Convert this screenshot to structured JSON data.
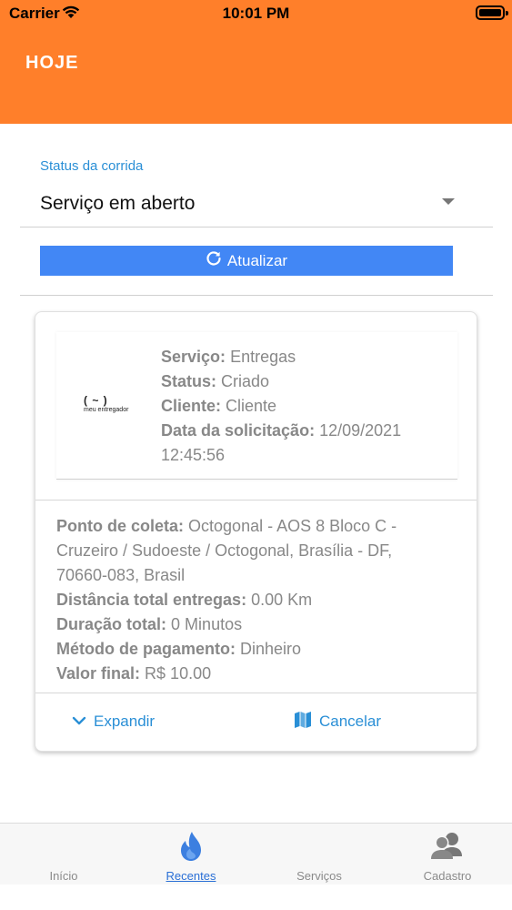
{
  "status_bar": {
    "carrier": "Carrier",
    "time": "10:01 PM"
  },
  "header": {
    "title": "HOJE",
    "color": "#ff7f2a"
  },
  "filter": {
    "label": "Status da corrida",
    "value": "Serviço em aberto"
  },
  "refresh_button": {
    "label": "Atualizar",
    "color": "#4287f5"
  },
  "card": {
    "head": [
      {
        "label": "Serviço:",
        "value": "Entregas"
      },
      {
        "label": "Status:",
        "value": "Criado"
      },
      {
        "label": "Cliente:",
        "value": "Cliente"
      },
      {
        "label": "Data da solicitação:",
        "value": "12/09/2021 12:45:56"
      }
    ],
    "logo_text": "meu entregador",
    "body": [
      {
        "label": "Ponto de coleta:",
        "value": "Octogonal - AOS 8 Bloco C - Cruzeiro / Sudoeste / Octogonal, Brasília - DF, 70660-083, Brasil"
      },
      {
        "label": "Distância total entregas:",
        "value": "0.00 Km"
      },
      {
        "label": "Duração total:",
        "value": "0 Minutos"
      },
      {
        "label": "Método de pagamento:",
        "value": "Dinheiro"
      },
      {
        "label": "Valor final:",
        "value": "R$ 10.00"
      }
    ],
    "actions": {
      "expand": "Expandir",
      "cancel": "Cancelar"
    }
  },
  "tabs": [
    {
      "label": "Início",
      "icon": "home-icon",
      "active": false
    },
    {
      "label": "Recentes",
      "icon": "flame-icon",
      "active": true
    },
    {
      "label": "Serviços",
      "icon": "services-icon",
      "active": false
    },
    {
      "label": "Cadastro",
      "icon": "users-icon",
      "active": false
    }
  ]
}
